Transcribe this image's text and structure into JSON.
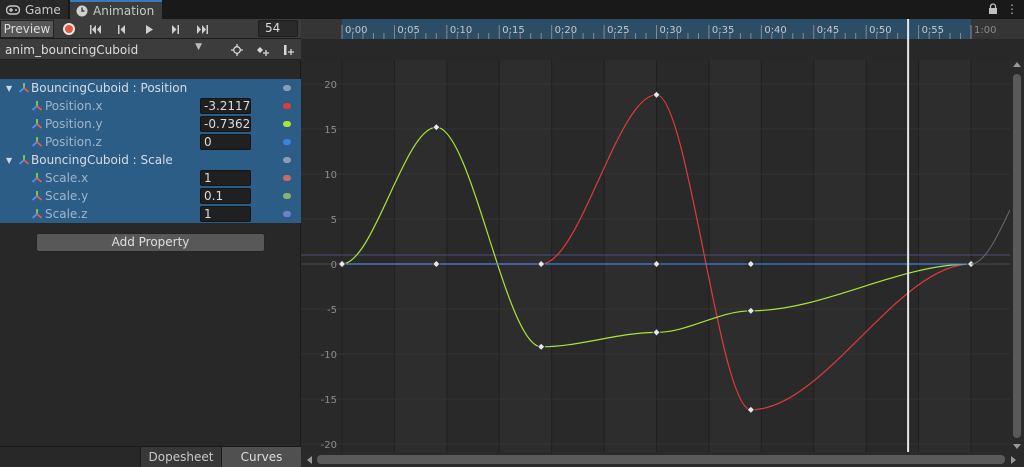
{
  "tabs": [
    {
      "label": "Game",
      "icon": "gamepad-icon"
    },
    {
      "label": "Animation",
      "icon": "clock-icon"
    }
  ],
  "toolbar": {
    "preview_label": "Preview",
    "record_color": "#e8563b",
    "frame_value": "54"
  },
  "clip": {
    "name": "anim_bouncingCuboid"
  },
  "properties": [
    {
      "type": "group",
      "label": "BouncingCuboid : Position"
    },
    {
      "type": "curve",
      "label": "Position.x",
      "value": "-3.2117",
      "color": "#e03a3a"
    },
    {
      "type": "curve",
      "label": "Position.y",
      "value": "-0.7362",
      "color": "#a8e636"
    },
    {
      "type": "curve",
      "label": "Position.z",
      "value": "0",
      "color": "#3f7fe0"
    },
    {
      "type": "group",
      "label": "BouncingCuboid : Scale"
    },
    {
      "type": "curve",
      "label": "Scale.x",
      "value": "1",
      "color": "#c86a6a"
    },
    {
      "type": "curve",
      "label": "Scale.y",
      "value": "0.1",
      "color": "#86b46c"
    },
    {
      "type": "curve",
      "label": "Scale.z",
      "value": "1",
      "color": "#6f80c9"
    }
  ],
  "add_property_label": "Add Property",
  "bottom_tabs": {
    "dopesheet": "Dopesheet",
    "curves": "Curves"
  },
  "timeline": {
    "ticks": [
      "0:00",
      "0:05",
      "0:10",
      "0:15",
      "0:20",
      "0:25",
      "0:30",
      "0:35",
      "0:40",
      "0:45",
      "0:50",
      "0:55",
      "1:00"
    ],
    "playhead_time": "0:54"
  },
  "curve_editor": {
    "y_labels": [
      "20",
      "15",
      "10",
      "5",
      "0",
      "-5",
      "-10",
      "-15",
      "-20"
    ],
    "x_range": [
      0,
      60
    ],
    "y_range": [
      -22,
      24
    ],
    "series": [
      {
        "name": "Position.x",
        "color": "#e03a3a",
        "keys": [
          [
            0,
            0
          ],
          [
            19,
            0
          ],
          [
            30,
            18.8
          ],
          [
            39,
            -16.2
          ],
          [
            60,
            0
          ]
        ]
      },
      {
        "name": "Position.y",
        "color": "#a8e636",
        "keys": [
          [
            0,
            0
          ],
          [
            9,
            15.2
          ],
          [
            19,
            -9.2
          ],
          [
            30,
            -7.6
          ],
          [
            39,
            -5.2
          ],
          [
            60,
            0
          ]
        ]
      },
      {
        "name": "Position.z",
        "color": "#3f7fe0",
        "keys": [
          [
            0,
            0
          ],
          [
            9,
            0
          ],
          [
            19,
            0
          ],
          [
            30,
            0
          ],
          [
            39,
            0
          ],
          [
            60,
            0
          ]
        ]
      }
    ]
  }
}
